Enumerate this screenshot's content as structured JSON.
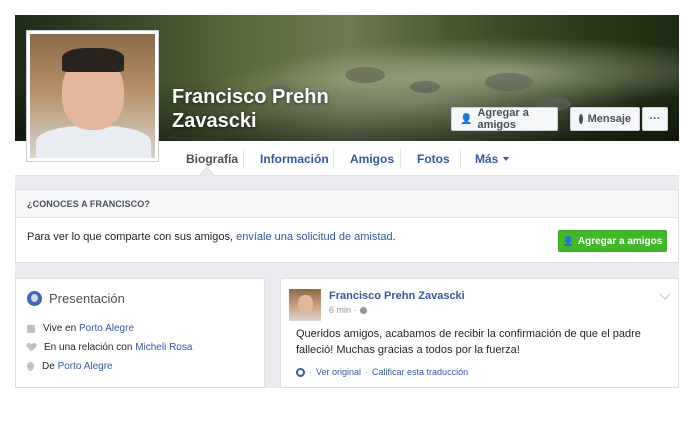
{
  "profile": {
    "name_line1": "Francisco Prehn",
    "name_line2": "Zavascki"
  },
  "cover_actions": {
    "add_friend": "Agregar a amigos",
    "message": "Mensaje",
    "more": "···"
  },
  "nav": {
    "tabs": [
      {
        "label": "Biografía",
        "active": true
      },
      {
        "label": "Información"
      },
      {
        "label": "Amigos"
      },
      {
        "label": "Fotos"
      },
      {
        "label": "Más"
      }
    ]
  },
  "know": {
    "heading": "¿CONOCES A FRANCISCO?",
    "text_before": "Para ver lo que comparte con sus amigos, ",
    "link": "envíale una solicitud de amistad",
    "text_after": ".",
    "button": "Agregar a amigos"
  },
  "intro": {
    "title": "Presentación",
    "rows": [
      {
        "prefix": "Vive en",
        "link": "Porto Alegre",
        "icon": "home-icon"
      },
      {
        "prefix": "En una relación con",
        "link": "Micheli Rosa",
        "icon": "heart-icon"
      },
      {
        "prefix": "De",
        "link": "Porto Alegre",
        "icon": "location-pin-icon"
      }
    ]
  },
  "post": {
    "author": "Francisco Prehn Zavascki",
    "time": "6 min",
    "separator": "·",
    "text": "Queridos amigos, acabamos de recibir la confirmación de que el padre falleció! Muchas gracias a todos por la fuerza!",
    "see_original": "Ver original",
    "rate_translation": "Calificar esta traducción",
    "foot_dot": "·"
  },
  "colors": {
    "link_blue": "#365899",
    "green_button": "#42b72a",
    "page_bg": "#e9ebee"
  }
}
